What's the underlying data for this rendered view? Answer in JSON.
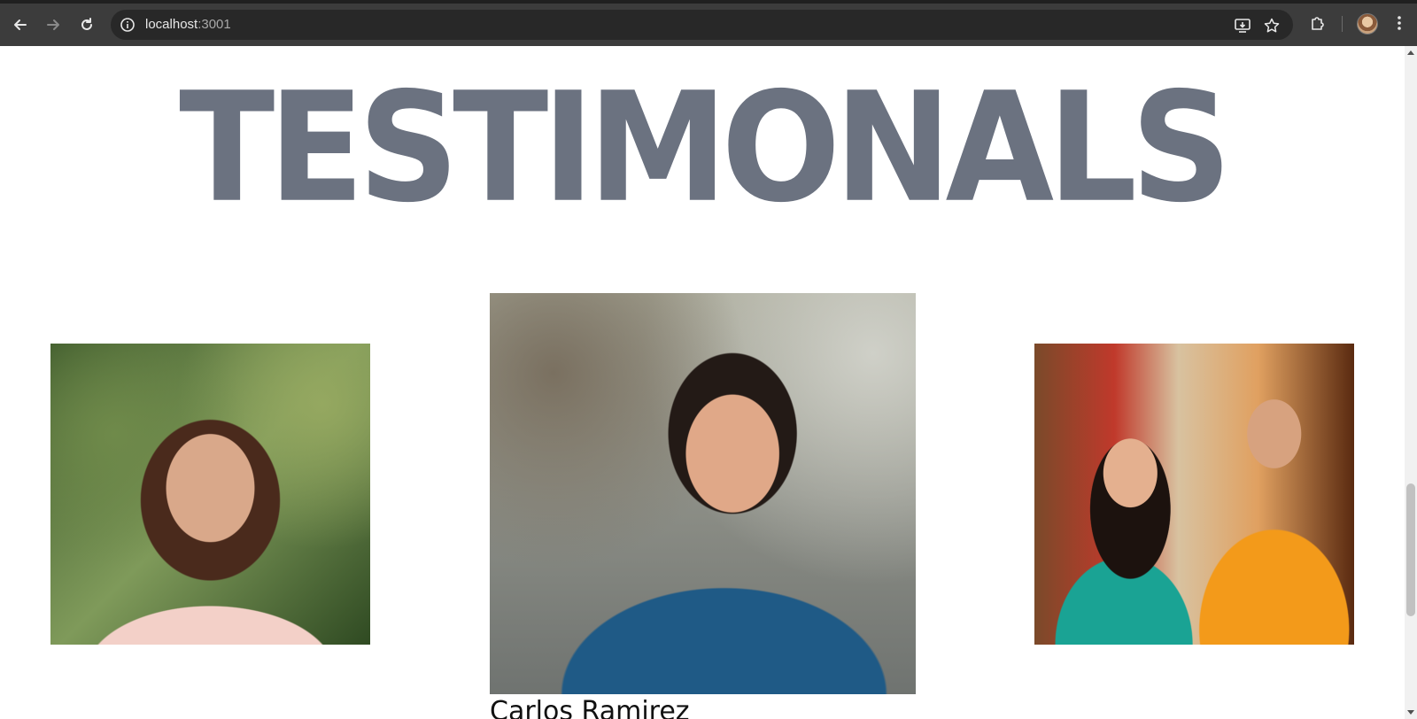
{
  "browser": {
    "url_host": "localhost",
    "url_port": ":3001",
    "icons": {
      "back": "arrow-left-icon",
      "forward": "arrow-right-icon",
      "reload": "reload-icon",
      "site_info": "info-icon",
      "install": "install-app-icon",
      "bookmark": "star-icon",
      "extensions": "puzzle-icon",
      "profile": "avatar",
      "menu": "kebab-menu-icon"
    }
  },
  "page": {
    "headline": "TESTIMONALS",
    "headline_color": "#6b7280",
    "photos": [
      {
        "name": "testimonial-photo-left"
      },
      {
        "name": "testimonial-photo-center"
      },
      {
        "name": "testimonial-photo-right"
      }
    ],
    "featured_caption": "Carlos Ramirez"
  }
}
